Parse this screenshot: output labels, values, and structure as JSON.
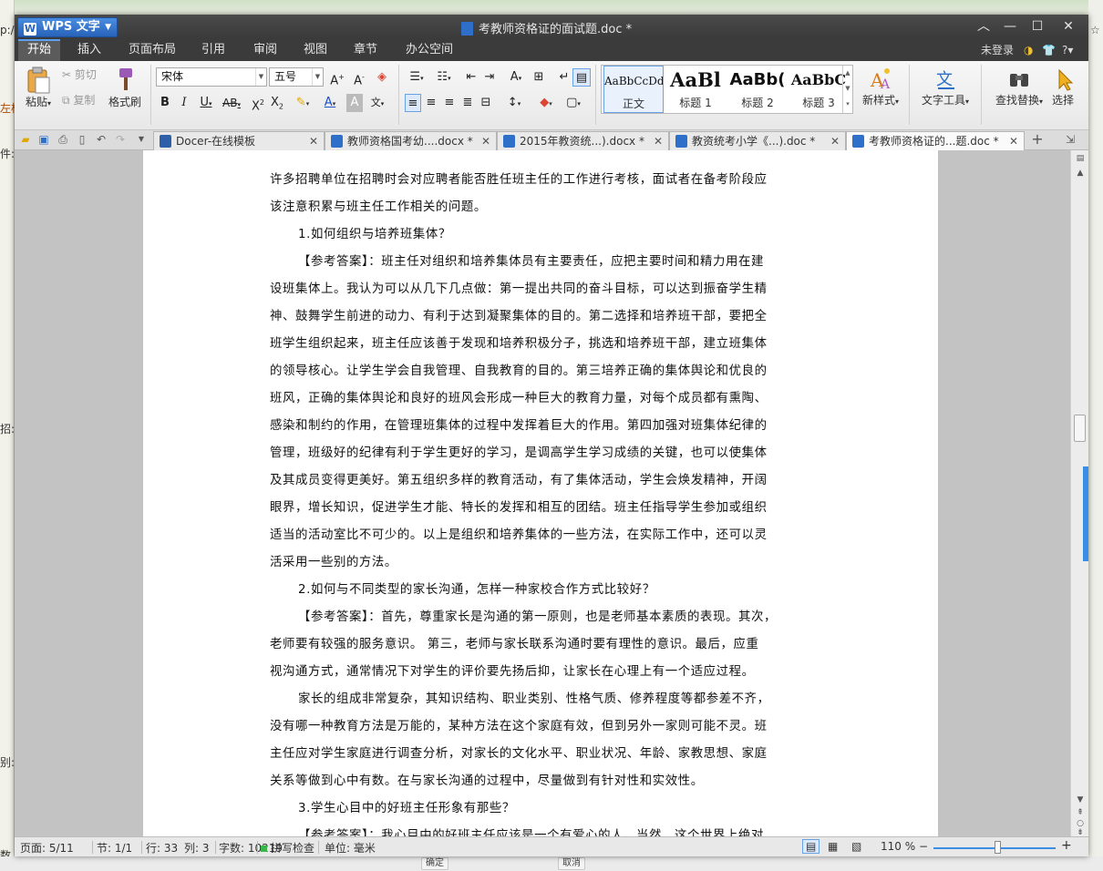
{
  "app": {
    "name": "WPS 文字",
    "doc_title": "考教师资格证的面试题.doc *"
  },
  "menu": {
    "items": [
      "开始",
      "插入",
      "页面布局",
      "引用",
      "审阅",
      "视图",
      "章节",
      "办公空间"
    ],
    "login": "未登录"
  },
  "ribbon": {
    "paste": "粘贴",
    "cut": "剪切",
    "copy": "复制",
    "format_painter": "格式刷",
    "font_name": "宋体",
    "font_size": "五号",
    "styles": [
      {
        "sample": "AaBbCcDd",
        "name": "正文"
      },
      {
        "sample": "AaBl",
        "name": "标题 1"
      },
      {
        "sample": "AaBb(",
        "name": "标题 2"
      },
      {
        "sample": "AaBbC",
        "name": "标题 3"
      }
    ],
    "new_style": "新样式",
    "text_tools": "文字工具",
    "find_replace": "查找替换",
    "select": "选择"
  },
  "tabs": [
    {
      "label": "Docer-在线模板"
    },
    {
      "label": "教师资格国考幼....docx *"
    },
    {
      "label": "2015年教资统...).docx *"
    },
    {
      "label": "教资统考小学《...).doc *"
    },
    {
      "label": "考教师资格证的...题.doc *"
    }
  ],
  "document": {
    "lines": [
      "许多招聘单位在招聘时会对应聘者能否胜任班主任的工作进行考核，面试者在备考阶段应",
      "该注意积累与班主任工作相关的问题。",
      "1.如何组织与培养班集体？",
      "【参考答案】：班主任对组织和培养集体员有主要责任，应把主要时间和精力用在建",
      "设班集体上。我认为可以从几下几点做：第一提出共同的奋斗目标，可以达到振奋学生精",
      "神、鼓舞学生前进的动力、有利于达到凝聚集体的目的。第二选择和培养班干部，要把全",
      "班学生组织起来，班主任应该善于发现和培养积极分子，挑选和培养班干部，建立班集体",
      "的领导核心。让学生学会自我管理、自我教育的目的。第三培养正确的集体舆论和优良的",
      "班风，正确的集体舆论和良好的班风会形成一种巨大的教育力量，对每个成员都有熏陶、",
      "感染和制约的作用，在管理班集体的过程中发挥着巨大的作用。第四加强对班集体纪律的",
      "管理，班级好的纪律有利于学生更好的学习，是调高学生学习成绩的关键，也可以使集体",
      "及其成员变得更美好。第五组织多样的教育活动，有了集体活动，学生会焕发精神，开阔",
      "眼界，增长知识，促进学生才能、特长的发挥和相互的团结。班主任指导学生参加或组织",
      "适当的活动室比不可少的。以上是组织和培养集体的一些方法，在实际工作中，还可以灵",
      "活采用一些别的方法。",
      "2.如何与不同类型的家长沟通，怎样一种家校合作方式比较好？",
      "【参考答案】：首先，尊重家长是沟通的第一原则，也是老师基本素质的表现。其次，",
      "老师要有较强的服务意识。 第三，老师与家长联系沟通时要有理性的意识。最后，应重",
      "视沟通方式，通常情况下对学生的评价要先扬后抑，让家长在心理上有一个适应过程。",
      "家长的组成非常复杂，其知识结构、职业类别、性格气质、修养程度等都参差不齐，",
      "没有哪一种教育方法是万能的，某种方法在这个家庭有效，但到另外一家则可能不灵。班",
      "主任应对学生家庭进行调查分析，对家长的文化水平、职业状况、年龄、家教思想、家庭",
      "关系等做到心中有数。在与家长沟通的过程中，尽量做到有针对性和实效性。",
      "3.学生心目中的好班主任形象有那些？",
      "【参考答案】：我心目中的好班主任应该是一个有爱心的人。当然，这个世界上绝对"
    ]
  },
  "status": {
    "page": "页面: 5/11",
    "section": "节: 1/1",
    "row": "行: 33",
    "col": "列: 3",
    "wordcount": "字数: 10219",
    "spellcheck": "拼写检查",
    "unit": "单位: 毫米",
    "zoom": "110 %"
  },
  "background": {
    "left_fragments": [
      "p:/",
      "左栏",
      "件:",
      "招:",
      "别:",
      "数"
    ],
    "right_fragments": [
      "☆"
    ],
    "taskbar_buttons": [
      "确定",
      "取消"
    ]
  },
  "colors": {
    "accent": "#3a8ee6",
    "titlebar": "#3f3f3f",
    "app_button": "#2863b8"
  }
}
